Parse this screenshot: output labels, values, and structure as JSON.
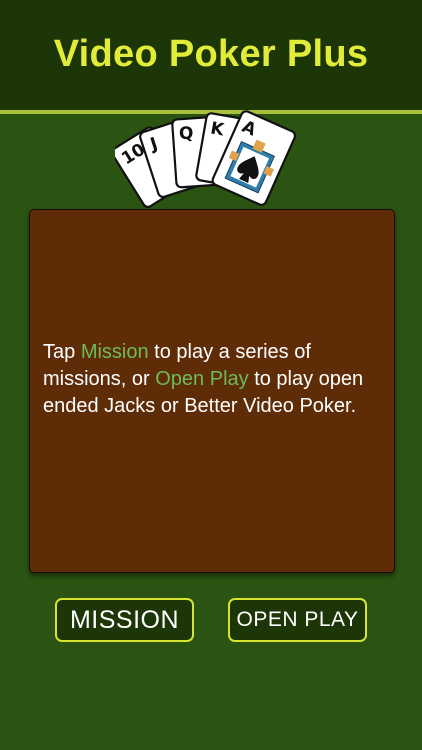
{
  "header": {
    "title": "Video Poker Plus"
  },
  "cards": [
    "10",
    "J",
    "Q",
    "K",
    "A"
  ],
  "info": {
    "part1": "Tap ",
    "mission_word": "Mission",
    "part2": " to play a series of missions, or ",
    "open_play_word": "Open Play",
    "part3": " to play open ended Jacks or Better Video Poker."
  },
  "buttons": {
    "mission_label": "MISSION",
    "open_play_label": "OPEN PLAY"
  },
  "colors": {
    "background": "#2b5311",
    "header": "#1c3608",
    "title": "#e1ec39",
    "panel": "#5e2d08",
    "highlight": "#6dbb58",
    "button_border": "#d6e431"
  }
}
